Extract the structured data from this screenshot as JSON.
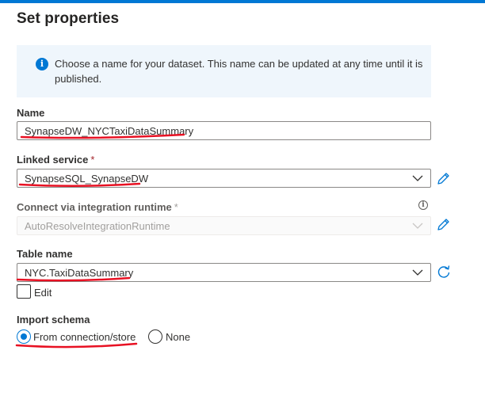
{
  "panel": {
    "title": "Set properties",
    "info_text": "Choose a name for your dataset. This name can be updated at any time until it is published."
  },
  "name_field": {
    "label": "Name",
    "value": "SynapseDW_NYCTaxiDataSummary"
  },
  "linked_service": {
    "label": "Linked service",
    "required_mark": "*",
    "value": "SynapseSQL_SynapseDW"
  },
  "integration_runtime": {
    "label": "Connect via integration runtime",
    "required_mark": "*",
    "value": "AutoResolveIntegrationRuntime"
  },
  "table_name": {
    "label": "Table name",
    "value": "NYC.TaxiDataSummary",
    "edit_label": "Edit",
    "edit_checked": false
  },
  "import_schema": {
    "label": "Import schema",
    "options": [
      {
        "label": "From connection/store",
        "selected": true
      },
      {
        "label": "None",
        "selected": false
      }
    ]
  },
  "colors": {
    "accent": "#0078d4",
    "annotation_underline": "#e81123",
    "info_background": "#eff6fc"
  },
  "icons": {
    "info": "info-icon",
    "help": "help-circle-icon",
    "edit": "pencil-icon",
    "refresh": "refresh-icon",
    "dropdown": "chevron-down-icon"
  }
}
